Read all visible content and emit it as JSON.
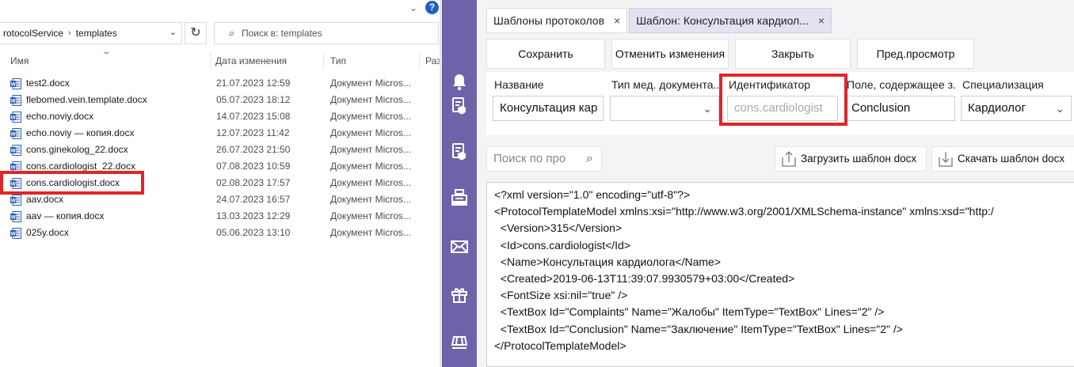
{
  "explorer": {
    "address": [
      "rotocolService",
      "templates"
    ],
    "search_placeholder": "Поиск в: templates",
    "columns": {
      "name": "Имя",
      "date": "Дата изменения",
      "type": "Тип",
      "size": "Раз"
    },
    "files": [
      {
        "name": "test2.docx",
        "date": "21.07.2023 12:59",
        "type": "Документ Micros..."
      },
      {
        "name": "flebomed.vein.template.docx",
        "date": "05.07.2023 18:12",
        "type": "Документ Micros..."
      },
      {
        "name": "echo.noviy.docx",
        "date": "14.07.2023 15:08",
        "type": "Документ Micros..."
      },
      {
        "name": "echo.noviy — копия.docx",
        "date": "12.07.2023 11:42",
        "type": "Документ Micros..."
      },
      {
        "name": "cons.ginekolog_22.docx",
        "date": "26.07.2023 21:50",
        "type": "Документ Micros..."
      },
      {
        "name": "cons.cardiologist_22.docx",
        "date": "07.08.2023 10:59",
        "type": "Документ Micros..."
      },
      {
        "name": "cons.cardiologist.docx",
        "date": "02.08.2023 17:57",
        "type": "Документ Micros..."
      },
      {
        "name": "aav.docx",
        "date": "24.07.2023 16:57",
        "type": "Документ Micros..."
      },
      {
        "name": "aav — копия.docx",
        "date": "13.03.2023 12:29",
        "type": "Документ Micros..."
      },
      {
        "name": "025y.docx",
        "date": "05.06.2023 13:10",
        "type": "Документ Micros..."
      }
    ],
    "help_label": "?"
  },
  "app": {
    "tabs": [
      {
        "label": "Шаблоны протоколов",
        "close": "×"
      },
      {
        "label": "Шаблон: Консультация кардиол...",
        "close": "×"
      }
    ],
    "toolbar": {
      "save": "Сохранить",
      "cancel": "Отменить изменения",
      "close": "Закрыть",
      "preview": "Пред.просмотр"
    },
    "fields": {
      "name_label": "Название",
      "name_value": "Консультация кар",
      "doctype_label": "Тип мед. документа...",
      "doctype_value": "",
      "id_label": "Идентификатор",
      "id_placeholder": "cons.cardiologist",
      "conclusion_label": "Поле, содержащее з...",
      "conclusion_value": "Conclusion",
      "spec_label": "Специализация",
      "spec_value": "Кардиолог"
    },
    "protocol_search_placeholder": "Поиск по про",
    "upload_label": "Загрузить шаблон docx",
    "download_label": "Скачать шаблон docx",
    "xml_lines": [
      "<?xml version=\"1.0\" encoding=\"utf-8\"?>",
      "<ProtocolTemplateModel xmlns:xsi=\"http://www.w3.org/2001/XMLSchema-instance\" xmlns:xsd=\"http:/",
      "  <Version>315</Version>",
      "  <Id>cons.cardiologist</Id>",
      "  <Name>Консультация кардиолога</Name>",
      "  <Created>2019-06-13T11:39:07.9930579+03:00</Created>",
      "  <FontSize xsi:nil=\"true\" />",
      "  <TextBox Id=\"Complaints\" Name=\"Жалобы\" ItemType=\"TextBox\" Lines=\"2\" />",
      "  <TextBox Id=\"Conclusion\" Name=\"Заключение\" ItemType=\"TextBox\" Lines=\"2\" />",
      "</ProtocolTemplateModel>"
    ],
    "rail_icons": [
      "bell-icon",
      "document-shield-icon",
      "document-shield-icon",
      "cash-register-icon",
      "mail-icon",
      "gift-icon",
      "table-icon"
    ]
  },
  "colors": {
    "rail": "#6e63a8",
    "highlight": "#e0252b",
    "active_tab": "#e4e1f1",
    "word_blue": "#2b5cb3"
  }
}
